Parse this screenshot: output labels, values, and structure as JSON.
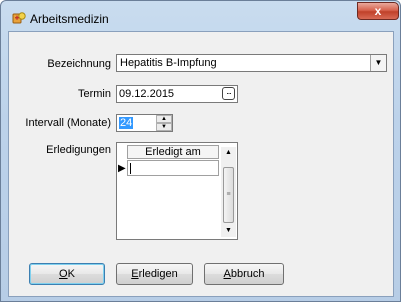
{
  "window": {
    "title": "Arbeitsmedizin",
    "close_glyph": "x"
  },
  "form": {
    "bezeichnung_label": "Bezeichnung",
    "bezeichnung_value": "Hepatitis B-Impfung",
    "termin_label": "Termin",
    "termin_value": "09.12.2015",
    "intervall_label": "Intervall (Monate)",
    "intervall_value": "24",
    "erledigungen_label": "Erledigungen"
  },
  "grid": {
    "columns": [
      "Erledigt am"
    ],
    "rows": [
      ""
    ],
    "row_marker": "▶"
  },
  "buttons": {
    "ok": {
      "accel": "O",
      "rest": "K"
    },
    "erledigen": {
      "accel": "E",
      "rest": "rledigen"
    },
    "abbruch": {
      "accel": "A",
      "rest": "bbruch"
    }
  },
  "icons": {
    "app": "arbeitsmedizin-app-icon",
    "dropdown": "chevron-down-icon",
    "calendar": "calendar-icon",
    "spin_up": "spin-up-icon",
    "spin_down": "spin-down-icon"
  }
}
